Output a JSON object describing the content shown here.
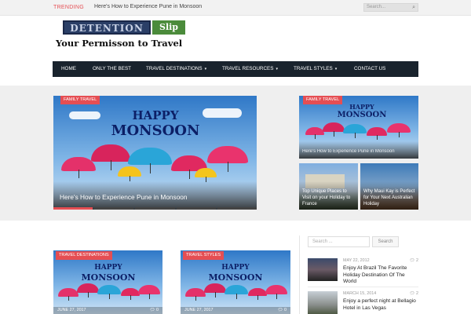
{
  "topbar": {
    "trending_label": "TRENDING",
    "trending_text": "Here's How to Experience Pune in Monsoon",
    "search_placeholder": "Search..."
  },
  "logo": {
    "word": "DETENTION",
    "slip": "Slip",
    "tagline": "Your Permisson to Travel"
  },
  "nav": {
    "items": [
      {
        "label": "HOME",
        "caret": false
      },
      {
        "label": "ONLY THE BEST",
        "caret": false
      },
      {
        "label": "TRAVEL DESTINATIONS",
        "caret": true
      },
      {
        "label": "TRAVEL RESOURCES",
        "caret": true
      },
      {
        "label": "TRAVEL STYLES",
        "caret": true
      },
      {
        "label": "CONTACT US",
        "caret": false
      }
    ]
  },
  "featured": {
    "main": {
      "category": "FAMILY TRAVEL",
      "title": "Here's How to Experience Pune in Monsoon",
      "graphic_line1": "HAPPY",
      "graphic_line2": "MONSOON"
    },
    "side_top": {
      "category": "FAMILY TRAVEL",
      "title": "Here's How to Experience Pune in Monsoon",
      "graphic_line1": "HAPPY",
      "graphic_line2": "MONSOON"
    },
    "side_left": {
      "title": "Top Unique Places to Visit on your Holiday to France"
    },
    "side_right": {
      "title": "Why Maui Kay is Perfect for Your Next Australian Holiday"
    },
    "slider_segments": 5,
    "active_segment": 1
  },
  "cards": [
    {
      "category": "TRAVEL DESTINATIONS",
      "graphic_line1": "HAPPY",
      "graphic_line2": "MONSOON",
      "date": "JUNE 27, 2017",
      "comments": "0"
    },
    {
      "category": "TRAVEL STYLES",
      "graphic_line1": "HAPPY",
      "graphic_line2": "MONSOON",
      "date": "JUNE 27, 2017",
      "comments": "0"
    }
  ],
  "sidebar": {
    "search_placeholder": "Search ...",
    "search_button": "Search",
    "posts": [
      {
        "date": "MAY 22, 2012",
        "comments": "2",
        "title": "Enjoy At Brazil The Favorite Holiday Destination Of The World"
      },
      {
        "date": "MARCH 15, 2014",
        "comments": "2",
        "title": "Enjoy a perfect night at Bellagio Hotel in Las Vegas"
      }
    ]
  },
  "icons": {
    "search": "search-icon",
    "comment": "comment-icon",
    "caret": "chevron-down-icon"
  },
  "colors": {
    "accent": "#e54e53",
    "nav_bg": "#19232d",
    "band_bg": "#efefef"
  }
}
